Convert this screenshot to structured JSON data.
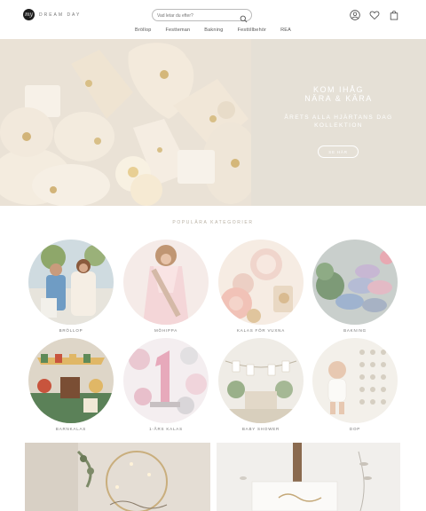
{
  "brand": {
    "logo_mark": "my",
    "name": "DREAM DAY"
  },
  "search": {
    "placeholder": "Vad letar du efter?"
  },
  "header_icons": [
    "account-icon",
    "wishlist-heart-icon",
    "shopping-bag-icon"
  ],
  "nav": {
    "items": [
      {
        "label": "Bröllop"
      },
      {
        "label": "Festteman"
      },
      {
        "label": "Bakning"
      },
      {
        "label": "Festtillbehör"
      },
      {
        "label": "REA"
      }
    ]
  },
  "hero": {
    "title_line1": "KOM IHÅG",
    "title_line2": "NÄRA & KÄRA",
    "subtitle_line1": "ÅRETS ALLA HJÄRTANS DAG",
    "subtitle_line2": "KOLLEKTION",
    "button": "SE HÄR"
  },
  "categories": {
    "heading": "POPULÄRA KATEGORIER",
    "items": [
      {
        "label": "BRÖLLOP"
      },
      {
        "label": "MÖHIPPA"
      },
      {
        "label": "KALAS FÖR VUXNA"
      },
      {
        "label": "BAKNING"
      },
      {
        "label": "BARNKALAS"
      },
      {
        "label": "1-ÅRS KALAS"
      },
      {
        "label": "BABY SHOWER"
      },
      {
        "label": "DOP"
      }
    ]
  },
  "colors": {
    "hero_panel": "#e5e0d6",
    "accent_text": "#b8b0a3"
  }
}
